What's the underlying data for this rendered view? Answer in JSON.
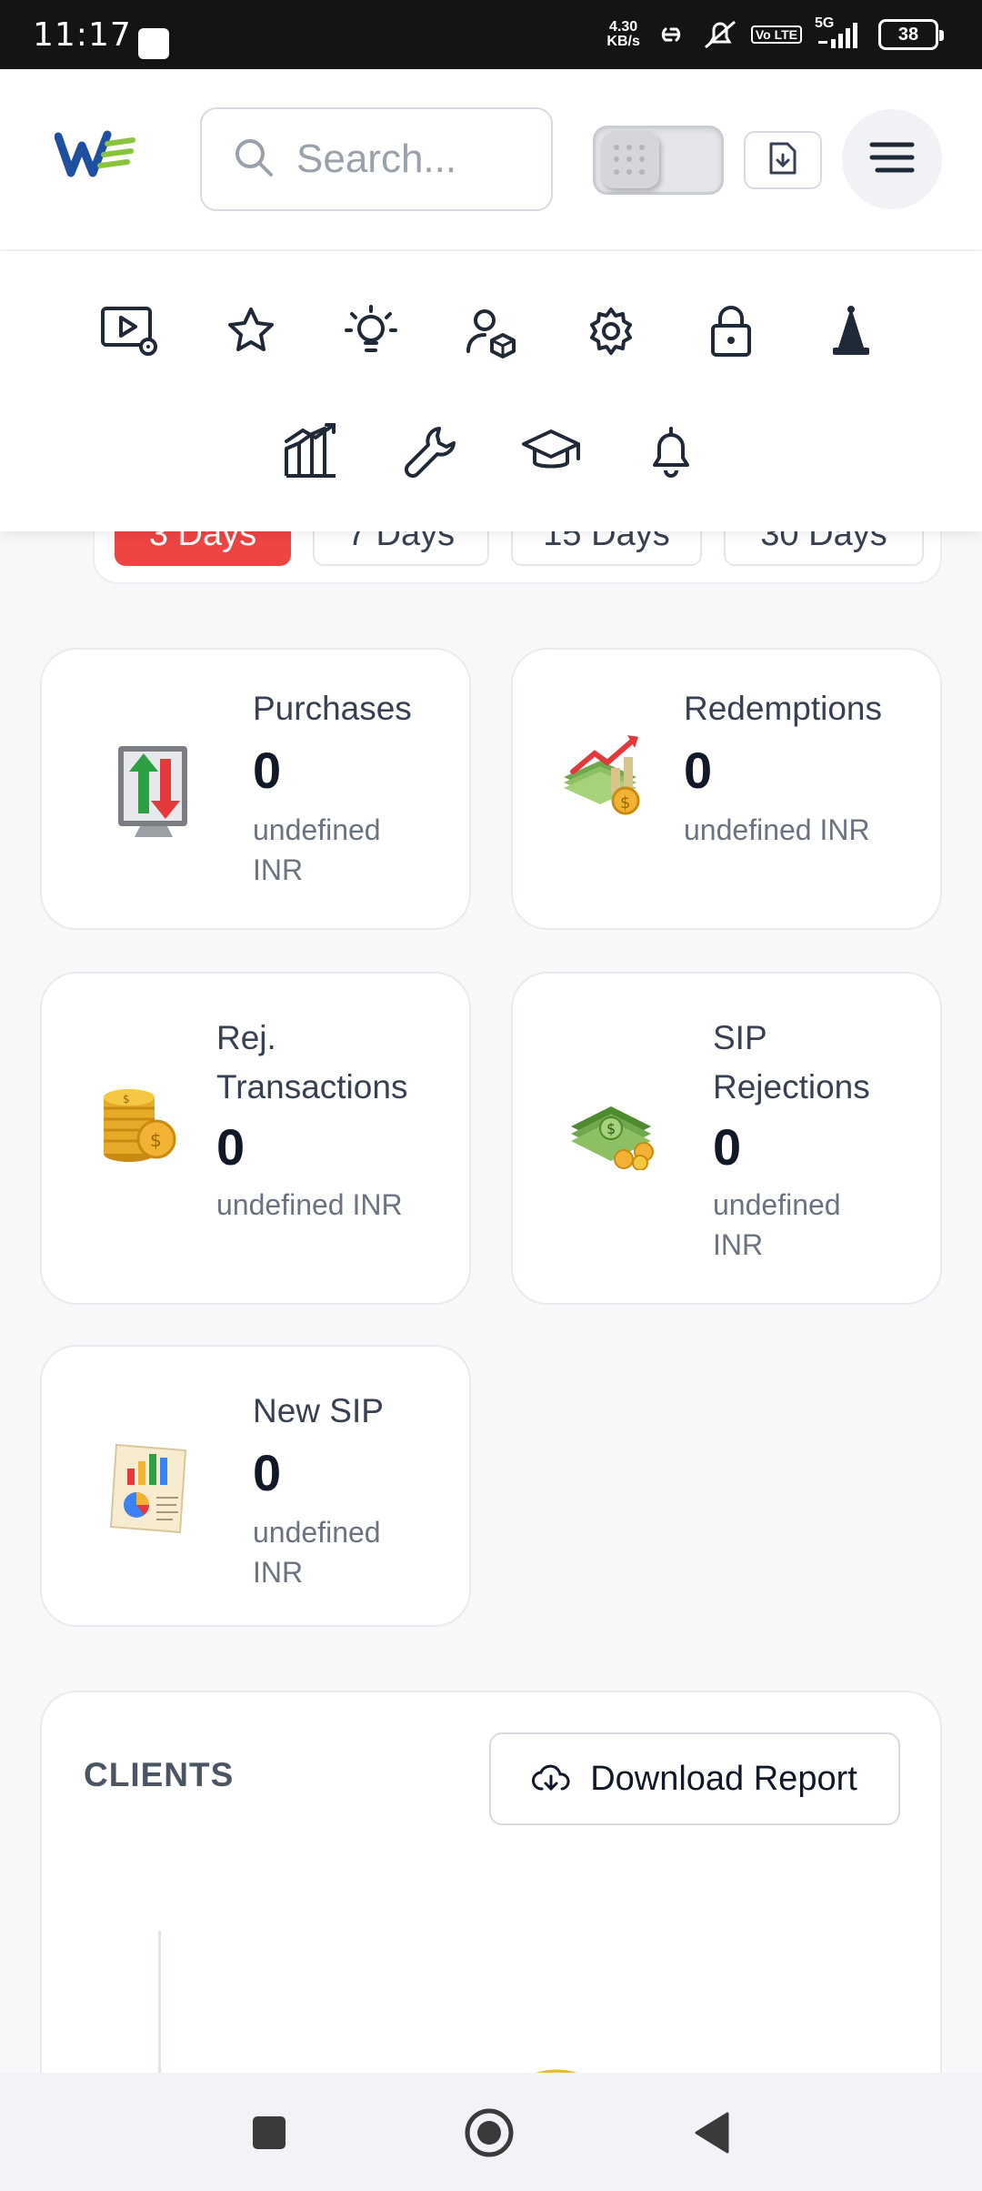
{
  "status_bar": {
    "time": "11:17",
    "net_speed_value": "4.30",
    "net_speed_unit": "KB/s",
    "volte": "Vo LTE",
    "network": "5G",
    "battery": "38"
  },
  "header": {
    "search_placeholder": "Search..."
  },
  "quick_icons": [
    "video-settings-icon",
    "star-icon",
    "lightbulb-icon",
    "user-cube-icon",
    "gear-icon",
    "lock-icon",
    "cone-icon",
    "chart-growth-icon",
    "wrench-icon",
    "graduation-cap-icon",
    "bell-icon"
  ],
  "period_tabs": [
    {
      "label": "3 Days",
      "active": true
    },
    {
      "label": "7 Days",
      "active": false
    },
    {
      "label": "15 Days",
      "active": false
    },
    {
      "label": "30 Days",
      "active": false
    }
  ],
  "stats": {
    "purchases": {
      "label": "Purchases",
      "value": "0",
      "sub1": "undefined",
      "sub2": "INR"
    },
    "redemptions": {
      "label": "Redemptions",
      "value": "0",
      "sub1": "undefined INR"
    },
    "rej_transactions": {
      "label1": "Rej.",
      "label2": "Transactions",
      "value": "0",
      "sub1": "undefined INR"
    },
    "sip_rejections": {
      "label1": "SIP",
      "label2": "Rejections",
      "value": "0",
      "sub1": "undefined",
      "sub2": "INR"
    },
    "new_sip": {
      "label": "New SIP",
      "value": "0",
      "sub1": "undefined",
      "sub2": "INR"
    }
  },
  "clients": {
    "title": "CLIENTS",
    "download_label": "Download Report"
  },
  "colors": {
    "accent_red": "#ef4444",
    "bubble_red": "#f26b6b",
    "bubble_green": "#4cc38a",
    "bubble_yellow": "#f5d36b",
    "bubble_blue": "#5b8def"
  }
}
